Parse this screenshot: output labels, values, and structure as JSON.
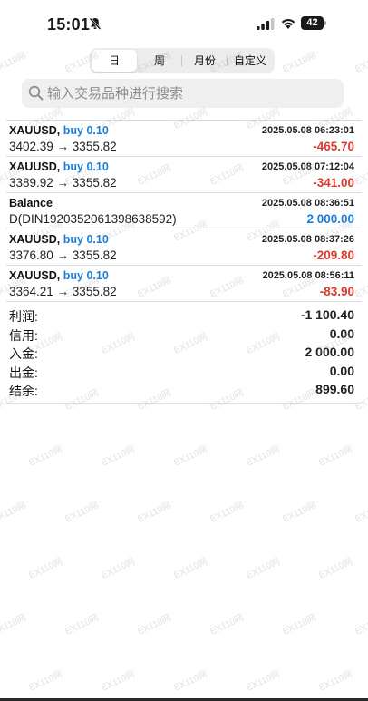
{
  "status_bar": {
    "time": "15:01",
    "battery": "42"
  },
  "tabs": [
    "日",
    "周",
    "月份",
    "自定义"
  ],
  "search": {
    "placeholder": "输入交易品种进行搜索"
  },
  "history": [
    {
      "title": "XAUUSD,",
      "action": "buy 0.10",
      "time": "2025.05.08 06:23:01",
      "detail": "3402.39 → 3355.82",
      "profit": "-465.70",
      "profit_color": "#d93b2f"
    },
    {
      "title": "XAUUSD,",
      "action": "buy 0.10",
      "time": "2025.05.08 07:12:04",
      "detail": "3389.92 → 3355.82",
      "profit": "-341.00",
      "profit_color": "#d93b2f"
    },
    {
      "title": "Balance",
      "action": "",
      "time": "2025.05.08 08:36:51",
      "detail": "D(DIN1920352061398638592)",
      "profit": "2 000.00",
      "profit_color": "#1a7fd8"
    },
    {
      "title": "XAUUSD,",
      "action": "buy 0.10",
      "time": "2025.05.08 08:37:26",
      "detail": "3376.80 → 3355.82",
      "profit": "-209.80",
      "profit_color": "#d93b2f"
    },
    {
      "title": "XAUUSD,",
      "action": "buy 0.10",
      "time": "2025.05.08 08:56:11",
      "detail": "3364.21 → 3355.82",
      "profit": "-83.90",
      "profit_color": "#d93b2f"
    }
  ],
  "summary": [
    {
      "label": "利润:",
      "value": "-1 100.40"
    },
    {
      "label": "信用:",
      "value": "0.00"
    },
    {
      "label": "入金:",
      "value": "2 000.00"
    },
    {
      "label": "出金:",
      "value": "0.00"
    },
    {
      "label": "结余:",
      "value": "899.60"
    }
  ],
  "watermark": "EX110网"
}
